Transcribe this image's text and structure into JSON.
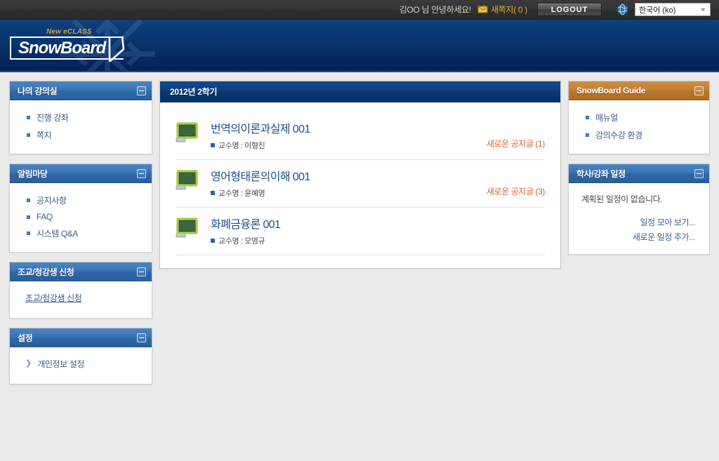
{
  "topbar": {
    "greeting": "김OO 님 안녕하세요!",
    "message_icon": "envelope-icon",
    "message_label": "새쪽지( 0 )",
    "logout_label": "LOGOUT",
    "globe_icon": "globe-icon",
    "language_value": "한국어 (ko)",
    "caret_icon": "chevron-down-icon",
    "accent_gold": "#d9b13c",
    "bar_color": "#2f3130"
  },
  "header": {
    "tagline": "New eCLASS",
    "logo": "SnowBoard",
    "brand_blue": "#063067",
    "tagline_color": "#d6a036"
  },
  "sidebar_left": {
    "panels": [
      {
        "title": "나의 강의실",
        "collapse_icon": "minus-box-icon",
        "items": [
          {
            "label": "진행 강좌"
          },
          {
            "label": "쪽지"
          }
        ]
      },
      {
        "title": "알림마당",
        "collapse_icon": "minus-box-icon",
        "items": [
          {
            "label": "공지사항"
          },
          {
            "label": "FAQ"
          },
          {
            "label": "시스템 Q&A"
          }
        ]
      },
      {
        "title": "조교/청강생 신청",
        "collapse_icon": "minus-box-icon",
        "plain_link": "조교/청강생 신청"
      },
      {
        "title": "설정",
        "collapse_icon": "minus-box-icon",
        "chevron_item": {
          "icon": "chevron-right-icon",
          "label": "개인정보 설정"
        }
      }
    ]
  },
  "main": {
    "header_title": "2012년 2학기",
    "courses": [
      {
        "icon": "monitor-icon",
        "title": "번역의이론과실제 001",
        "professor": "교수명 : 이형진",
        "notice": "새로운 공지글 (1)"
      },
      {
        "icon": "monitor-icon",
        "title": "영어형태론의이해 001",
        "professor": "교수명 : 윤혜영",
        "notice": "새로운 공지글 (3)"
      },
      {
        "icon": "monitor-icon",
        "title": "화폐금융론 001",
        "professor": "교수명 : 모영규",
        "notice": ""
      }
    ],
    "notice_color": "#df5f2a",
    "title_color": "#1d4f93"
  },
  "sidebar_right": {
    "guide_panel": {
      "title": "SnowBoard Guide",
      "collapse_icon": "minus-box-icon",
      "header_color": "#ba7528",
      "items": [
        {
          "label": "매뉴얼"
        },
        {
          "label": "강의수강 환경"
        }
      ]
    },
    "schedule_panel": {
      "title": "학사/강좌 일정",
      "collapse_icon": "minus-box-icon",
      "empty_text": "계획된 일정이 없습니다.",
      "links": [
        {
          "label": "일정 모아 보기..."
        },
        {
          "label": "새로운 일정 추가..."
        }
      ]
    }
  }
}
